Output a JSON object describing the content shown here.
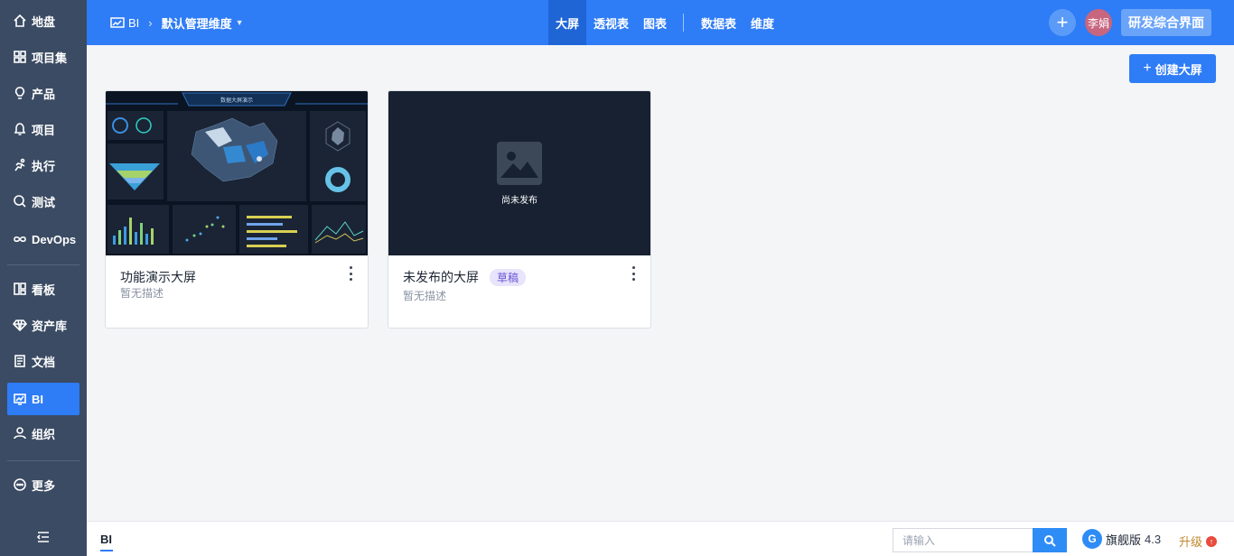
{
  "sidebar": {
    "items": [
      {
        "label": "地盘",
        "icon": "home-icon"
      },
      {
        "label": "项目集",
        "icon": "grid-icon"
      },
      {
        "label": "产品",
        "icon": "lightbulb-icon"
      },
      {
        "label": "项目",
        "icon": "bell-icon"
      },
      {
        "label": "执行",
        "icon": "run-icon"
      },
      {
        "label": "测试",
        "icon": "search-circle-icon"
      },
      {
        "label": "DevOps",
        "icon": "infinity-icon"
      },
      {
        "label": "看板",
        "icon": "kanban-icon"
      },
      {
        "label": "资产库",
        "icon": "diamond-icon"
      },
      {
        "label": "文档",
        "icon": "document-icon"
      },
      {
        "label": "BI",
        "icon": "monitor-chart-icon"
      },
      {
        "label": "组织",
        "icon": "user-icon"
      },
      {
        "label": "更多",
        "icon": "more-circle-icon"
      }
    ],
    "active": "BI"
  },
  "header": {
    "module": "BI",
    "dimension": "默认管理维度",
    "tabs": [
      "大屏",
      "透视表",
      "图表",
      "数据表",
      "维度"
    ],
    "active_tab": "大屏",
    "avatar_name": "李娟",
    "product_button": "研发综合界面",
    "add_symbol": "+"
  },
  "main": {
    "create_button": "创建大屏",
    "cards": [
      {
        "title": "功能演示大屏",
        "desc": "暂无描述",
        "badge": "",
        "thumb_caption": "数据大屏演示"
      },
      {
        "title": "未发布的大屏",
        "desc": "暂无描述",
        "badge": "草稿",
        "thumb_caption": "尚未发布"
      }
    ]
  },
  "footer": {
    "tab": "BI",
    "search_placeholder": "请输入",
    "edition": "旗舰版",
    "version": "4.3",
    "upgrade": "升级",
    "upgrade_symbol": "↑"
  },
  "colors": {
    "primary": "#2e7cf6",
    "sidebar": "#3b4b63",
    "badge_bg": "#e8e4fb",
    "badge_text": "#6a55d6"
  }
}
